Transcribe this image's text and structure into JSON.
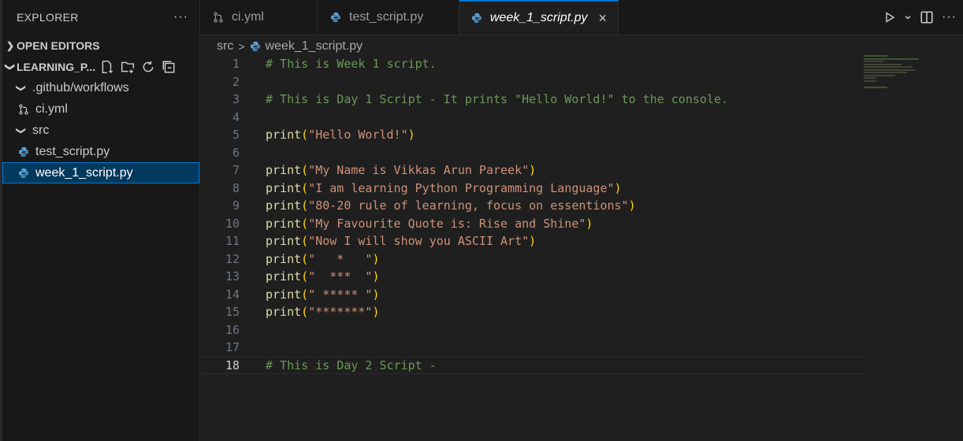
{
  "explorer": {
    "title": "EXPLORER",
    "more": "···",
    "open_editors": "OPEN EDITORS",
    "project": "LEARNING_P...",
    "tree": {
      "github_folder": ".github/workflows",
      "ci_file": "ci.yml",
      "src_folder": "src",
      "test_file": "test_script.py",
      "week_file": "week_1_script.py"
    }
  },
  "tabs": [
    {
      "label": "ci.yml",
      "icon": "git-pull-request-icon"
    },
    {
      "label": "test_script.py",
      "icon": "python-icon"
    },
    {
      "label": "week_1_script.py",
      "icon": "python-icon",
      "close": "×"
    }
  ],
  "breadcrumb": {
    "folder": "src",
    "separator": ">",
    "file": "week_1_script.py"
  },
  "code": [
    {
      "n": "1",
      "type": "comment",
      "text": "# This is Week 1 script."
    },
    {
      "n": "2",
      "type": "blank",
      "text": ""
    },
    {
      "n": "3",
      "type": "comment",
      "text": "# This is Day 1 Script - It prints \"Hello World!\" to the console."
    },
    {
      "n": "4",
      "type": "blank",
      "text": ""
    },
    {
      "n": "5",
      "type": "print",
      "text": "\"Hello World!\""
    },
    {
      "n": "6",
      "type": "blank",
      "text": ""
    },
    {
      "n": "7",
      "type": "print",
      "text": "\"My Name is Vikkas Arun Pareek\""
    },
    {
      "n": "8",
      "type": "print",
      "text": "\"I am learning Python Programming Language\""
    },
    {
      "n": "9",
      "type": "print",
      "text": "\"80-20 rule of learning, focus on essentions\""
    },
    {
      "n": "10",
      "type": "print",
      "text": "\"My Favourite Quote is: Rise and Shine\""
    },
    {
      "n": "11",
      "type": "print",
      "text": "\"Now I will show you ASCII Art\""
    },
    {
      "n": "12",
      "type": "print",
      "text": "\"   *   \""
    },
    {
      "n": "13",
      "type": "print",
      "text": "\"  ***  \""
    },
    {
      "n": "14",
      "type": "print",
      "text": "\" ***** \""
    },
    {
      "n": "15",
      "type": "print",
      "text": "\"*******\""
    },
    {
      "n": "16",
      "type": "blank",
      "text": ""
    },
    {
      "n": "17",
      "type": "blank",
      "text": ""
    },
    {
      "n": "18",
      "type": "comment",
      "text": "# This is Day 2 Script -",
      "current": true
    }
  ],
  "print_keyword": "print",
  "colors": {
    "accent": "#0078d4",
    "comment": "#6a9955",
    "string": "#ce9178",
    "function": "#dcdcaa",
    "paren": "#ffd700"
  }
}
